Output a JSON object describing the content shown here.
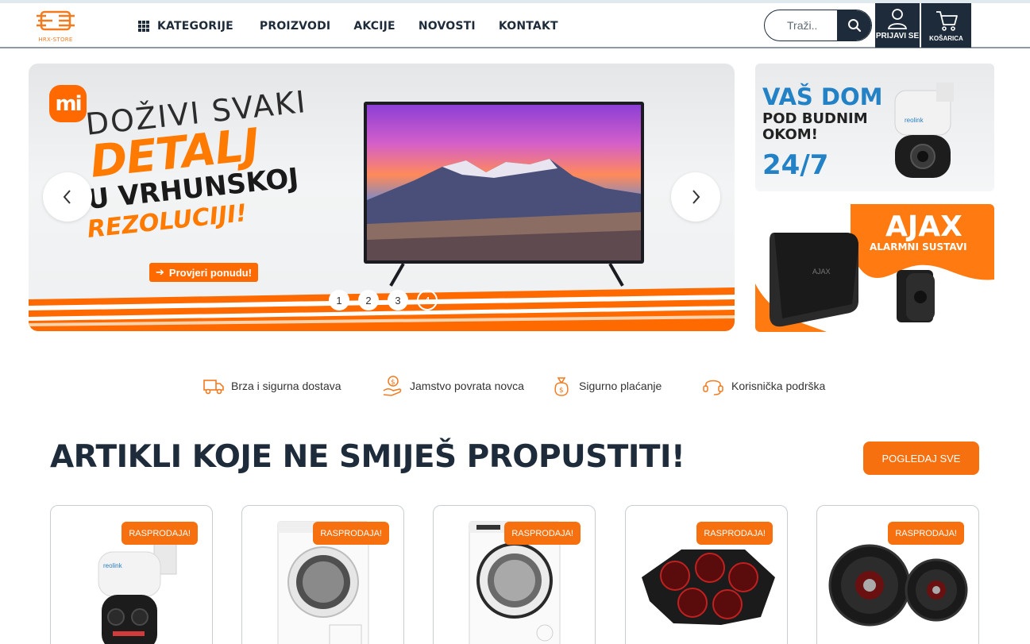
{
  "header": {
    "logo_text": "HRX-STORE",
    "nav": [
      {
        "label": "KATEGORIJE"
      },
      {
        "label": "PROIZVODI"
      },
      {
        "label": "AKCIJE"
      },
      {
        "label": "NOVOSTI"
      },
      {
        "label": "KONTAKT"
      }
    ],
    "search_placeholder": "Traži..",
    "login_label": "PRIJAVI SE",
    "cart_label": "KOŠARICA"
  },
  "hero": {
    "brand": "mi",
    "line1": "DOŽIVI SVAKI",
    "line2": "DETALJ",
    "line3": "U VRHUNSKOJ",
    "line4": "REZOLUCIJI!",
    "cta": "Provjeri ponudu!",
    "dots": [
      "1",
      "2",
      "3",
      "4"
    ],
    "active_dot": 4
  },
  "side_banners": {
    "security": {
      "line1": "VAŠ DOM",
      "line2a": "POD BUDNIM",
      "line2b": "OKOM!",
      "line3": "24/7",
      "brand": "reolink"
    },
    "alarm": {
      "title": "AJAX",
      "subtitle": "ALARMNI SUSTAVI",
      "brand": "AJAX"
    }
  },
  "features": [
    {
      "label": "Brza i sigurna dostava",
      "icon": "truck-icon"
    },
    {
      "label": "Jamstvo povrata novca",
      "icon": "money-hand-icon"
    },
    {
      "label": "Sigurno plaćanje",
      "icon": "money-bag-icon"
    },
    {
      "label": "Korisnička podrška",
      "icon": "headset-icon"
    }
  ],
  "section": {
    "title": "ARTIKLI KOJE NE SMIJEŠ PROPUSTITI!",
    "view_all": "POGLEDAJ SVE"
  },
  "products": [
    {
      "badge": "RASPRODAJA!",
      "image": "ptz-camera"
    },
    {
      "badge": "RASPRODAJA!",
      "image": "dryer"
    },
    {
      "badge": "RASPRODAJA!",
      "image": "dryer"
    },
    {
      "badge": "RASPRODAJA!",
      "image": "laptop-cooler"
    },
    {
      "badge": "RASPRODAJA!",
      "image": "car-speakers"
    }
  ],
  "colors": {
    "accent": "#f6700f",
    "navy": "#1d2b3a",
    "blue": "#2382c6"
  }
}
